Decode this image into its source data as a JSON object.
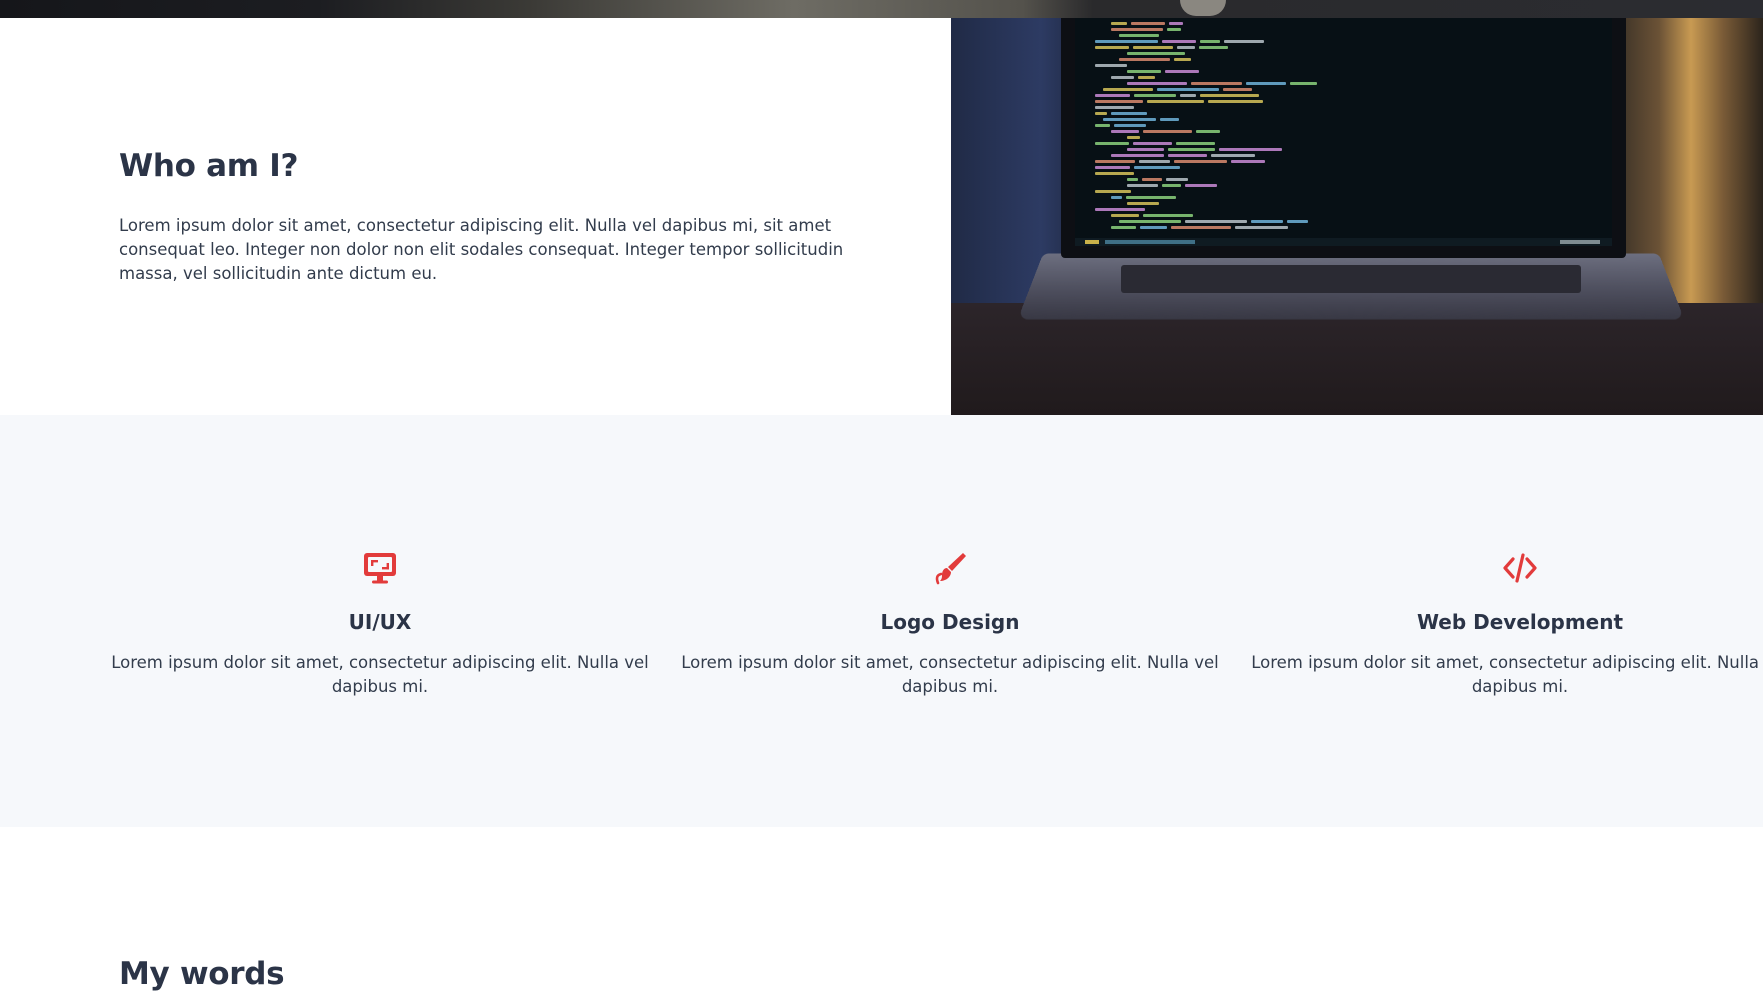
{
  "about": {
    "title": "Who am I?",
    "text": "Lorem ipsum dolor sit amet, consectetur adipiscing elit. Nulla vel dapibus mi, sit amet consequat leo. Integer non dolor non elit sodales consequat. Integer tempor sollicitudin massa, vel sollicitudin ante dictum eu."
  },
  "services": [
    {
      "icon": "desktop-icon",
      "title": "UI/UX",
      "description": "Lorem ipsum dolor sit amet, consectetur adipiscing elit. Nulla vel dapibus mi."
    },
    {
      "icon": "paintbrush-icon",
      "title": "Logo Design",
      "description": "Lorem ipsum dolor sit amet, consectetur adipiscing elit. Nulla vel dapibus mi."
    },
    {
      "icon": "code-icon",
      "title": "Web Development",
      "description": "Lorem ipsum dolor sit amet, consectetur adipiscing elit. Nulla vel dapibus mi."
    }
  ],
  "next_section": {
    "title": "My words"
  },
  "colors": {
    "accent": "#e23b3b",
    "heading": "#2b3447",
    "services_bg": "#f6f8fb"
  }
}
